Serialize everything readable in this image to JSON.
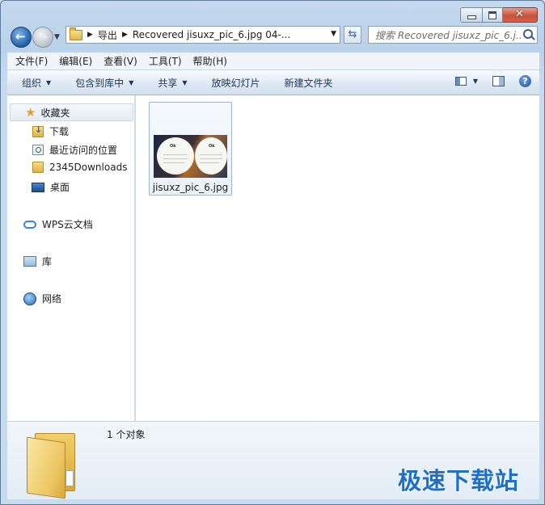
{
  "address": {
    "crumbs": [
      "导出",
      "Recovered jisuxz_pic_6.jpg 04-..."
    ]
  },
  "search": {
    "placeholder": "搜索 Recovered jisuxz_pic_6.j..."
  },
  "menu": [
    "文件(F)",
    "编辑(E)",
    "查看(V)",
    "工具(T)",
    "帮助(H)"
  ],
  "toolbar": {
    "organize": "组织",
    "include_library": "包含到库中",
    "share": "共享",
    "slideshow": "放映幻灯片",
    "new_folder": "新建文件夹"
  },
  "nav": {
    "favorites": "收藏夹",
    "downloads": "下载",
    "recent": "最近访问的位置",
    "folder_2345": "2345Downloads",
    "desktop": "桌面",
    "wps": "WPS云文档",
    "library": "库",
    "network": "网络"
  },
  "files": [
    {
      "name": "jisuxz_pic_6.jpg"
    }
  ],
  "details": {
    "count_text": "1 个对象"
  },
  "watermark": "极速下载站",
  "colors": {
    "accent": "#1d6fc8",
    "close_button": "#c7503a"
  }
}
